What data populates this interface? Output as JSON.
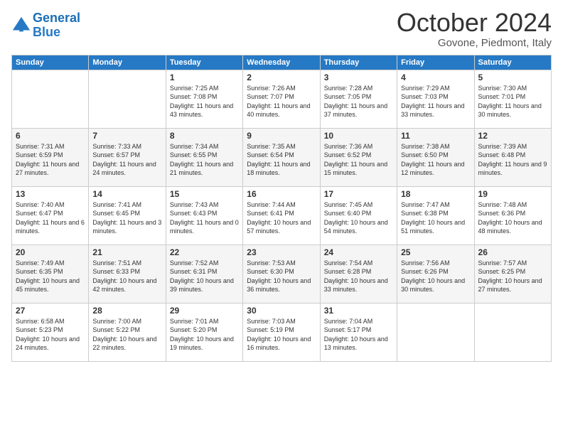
{
  "header": {
    "logo_line1": "General",
    "logo_line2": "Blue",
    "month": "October 2024",
    "location": "Govone, Piedmont, Italy"
  },
  "days_of_week": [
    "Sunday",
    "Monday",
    "Tuesday",
    "Wednesday",
    "Thursday",
    "Friday",
    "Saturday"
  ],
  "weeks": [
    [
      {
        "day": "",
        "info": ""
      },
      {
        "day": "",
        "info": ""
      },
      {
        "day": "1",
        "info": "Sunrise: 7:25 AM\nSunset: 7:08 PM\nDaylight: 11 hours and 43 minutes."
      },
      {
        "day": "2",
        "info": "Sunrise: 7:26 AM\nSunset: 7:07 PM\nDaylight: 11 hours and 40 minutes."
      },
      {
        "day": "3",
        "info": "Sunrise: 7:28 AM\nSunset: 7:05 PM\nDaylight: 11 hours and 37 minutes."
      },
      {
        "day": "4",
        "info": "Sunrise: 7:29 AM\nSunset: 7:03 PM\nDaylight: 11 hours and 33 minutes."
      },
      {
        "day": "5",
        "info": "Sunrise: 7:30 AM\nSunset: 7:01 PM\nDaylight: 11 hours and 30 minutes."
      }
    ],
    [
      {
        "day": "6",
        "info": "Sunrise: 7:31 AM\nSunset: 6:59 PM\nDaylight: 11 hours and 27 minutes."
      },
      {
        "day": "7",
        "info": "Sunrise: 7:33 AM\nSunset: 6:57 PM\nDaylight: 11 hours and 24 minutes."
      },
      {
        "day": "8",
        "info": "Sunrise: 7:34 AM\nSunset: 6:55 PM\nDaylight: 11 hours and 21 minutes."
      },
      {
        "day": "9",
        "info": "Sunrise: 7:35 AM\nSunset: 6:54 PM\nDaylight: 11 hours and 18 minutes."
      },
      {
        "day": "10",
        "info": "Sunrise: 7:36 AM\nSunset: 6:52 PM\nDaylight: 11 hours and 15 minutes."
      },
      {
        "day": "11",
        "info": "Sunrise: 7:38 AM\nSunset: 6:50 PM\nDaylight: 11 hours and 12 minutes."
      },
      {
        "day": "12",
        "info": "Sunrise: 7:39 AM\nSunset: 6:48 PM\nDaylight: 11 hours and 9 minutes."
      }
    ],
    [
      {
        "day": "13",
        "info": "Sunrise: 7:40 AM\nSunset: 6:47 PM\nDaylight: 11 hours and 6 minutes."
      },
      {
        "day": "14",
        "info": "Sunrise: 7:41 AM\nSunset: 6:45 PM\nDaylight: 11 hours and 3 minutes."
      },
      {
        "day": "15",
        "info": "Sunrise: 7:43 AM\nSunset: 6:43 PM\nDaylight: 11 hours and 0 minutes."
      },
      {
        "day": "16",
        "info": "Sunrise: 7:44 AM\nSunset: 6:41 PM\nDaylight: 10 hours and 57 minutes."
      },
      {
        "day": "17",
        "info": "Sunrise: 7:45 AM\nSunset: 6:40 PM\nDaylight: 10 hours and 54 minutes."
      },
      {
        "day": "18",
        "info": "Sunrise: 7:47 AM\nSunset: 6:38 PM\nDaylight: 10 hours and 51 minutes."
      },
      {
        "day": "19",
        "info": "Sunrise: 7:48 AM\nSunset: 6:36 PM\nDaylight: 10 hours and 48 minutes."
      }
    ],
    [
      {
        "day": "20",
        "info": "Sunrise: 7:49 AM\nSunset: 6:35 PM\nDaylight: 10 hours and 45 minutes."
      },
      {
        "day": "21",
        "info": "Sunrise: 7:51 AM\nSunset: 6:33 PM\nDaylight: 10 hours and 42 minutes."
      },
      {
        "day": "22",
        "info": "Sunrise: 7:52 AM\nSunset: 6:31 PM\nDaylight: 10 hours and 39 minutes."
      },
      {
        "day": "23",
        "info": "Sunrise: 7:53 AM\nSunset: 6:30 PM\nDaylight: 10 hours and 36 minutes."
      },
      {
        "day": "24",
        "info": "Sunrise: 7:54 AM\nSunset: 6:28 PM\nDaylight: 10 hours and 33 minutes."
      },
      {
        "day": "25",
        "info": "Sunrise: 7:56 AM\nSunset: 6:26 PM\nDaylight: 10 hours and 30 minutes."
      },
      {
        "day": "26",
        "info": "Sunrise: 7:57 AM\nSunset: 6:25 PM\nDaylight: 10 hours and 27 minutes."
      }
    ],
    [
      {
        "day": "27",
        "info": "Sunrise: 6:58 AM\nSunset: 5:23 PM\nDaylight: 10 hours and 24 minutes."
      },
      {
        "day": "28",
        "info": "Sunrise: 7:00 AM\nSunset: 5:22 PM\nDaylight: 10 hours and 22 minutes."
      },
      {
        "day": "29",
        "info": "Sunrise: 7:01 AM\nSunset: 5:20 PM\nDaylight: 10 hours and 19 minutes."
      },
      {
        "day": "30",
        "info": "Sunrise: 7:03 AM\nSunset: 5:19 PM\nDaylight: 10 hours and 16 minutes."
      },
      {
        "day": "31",
        "info": "Sunrise: 7:04 AM\nSunset: 5:17 PM\nDaylight: 10 hours and 13 minutes."
      },
      {
        "day": "",
        "info": ""
      },
      {
        "day": "",
        "info": ""
      }
    ]
  ]
}
